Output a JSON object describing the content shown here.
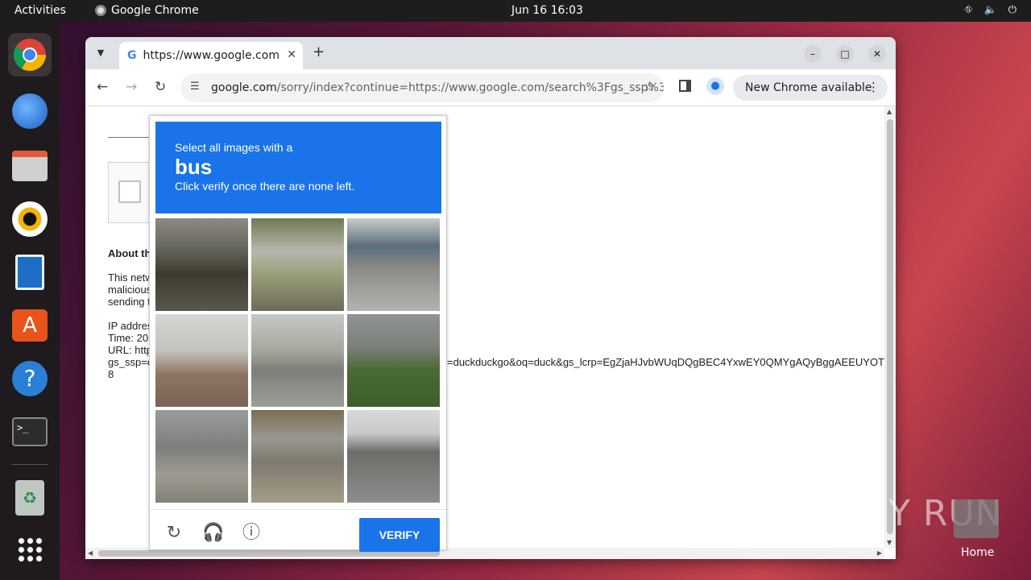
{
  "topbar": {
    "activities": "Activities",
    "app_name": "Google Chrome",
    "clock": "Jun 16  16:03"
  },
  "dock": {
    "items": [
      {
        "icon": "chrome-icon"
      },
      {
        "icon": "thunderbird-icon"
      },
      {
        "icon": "files-icon"
      },
      {
        "icon": "rhythmbox-icon"
      },
      {
        "icon": "writer-icon"
      },
      {
        "icon": "app-center-icon"
      },
      {
        "icon": "help-icon"
      },
      {
        "icon": "terminal-icon"
      },
      {
        "icon": "trash-icon"
      },
      {
        "icon": "show-apps-icon"
      }
    ]
  },
  "browser": {
    "tab_title": "https://www.google.com",
    "tab_favicon": "G",
    "url_host": "google.com",
    "url_path": "/sorry/index?continue=https://www.google.com/search%3Fgs_ssp%3...",
    "update_label": "New Chrome available"
  },
  "page": {
    "about": "About th",
    "para_lines": [
      "This netw",
      "malicious",
      "sending t"
    ],
    "ip_lines": [
      "IP addres",
      "Time: 20",
      "URL: http",
      "gs_ssp=e",
      "8"
    ],
    "url_tail": "=duckduckgo&oq=duck&gs_lcrp=EgZjaHJvbWUqDQgBEC4YxwEY0QMYgAQyBggAEEUYOT"
  },
  "captcha": {
    "line1": "Select all images with a",
    "target": "bus",
    "line3": "Click verify once there are none left.",
    "verify_label": "VERIFY",
    "tiles": [
      "street-wall-image",
      "bus-rear-image",
      "bus-street-image",
      "building-palm-image",
      "road-intersection-image",
      "overpass-grass-image",
      "stairs-building-image",
      "bus-side-image",
      "highway-image"
    ]
  },
  "desktop": {
    "watermark": "ANY RUN",
    "home_label": "Home"
  }
}
